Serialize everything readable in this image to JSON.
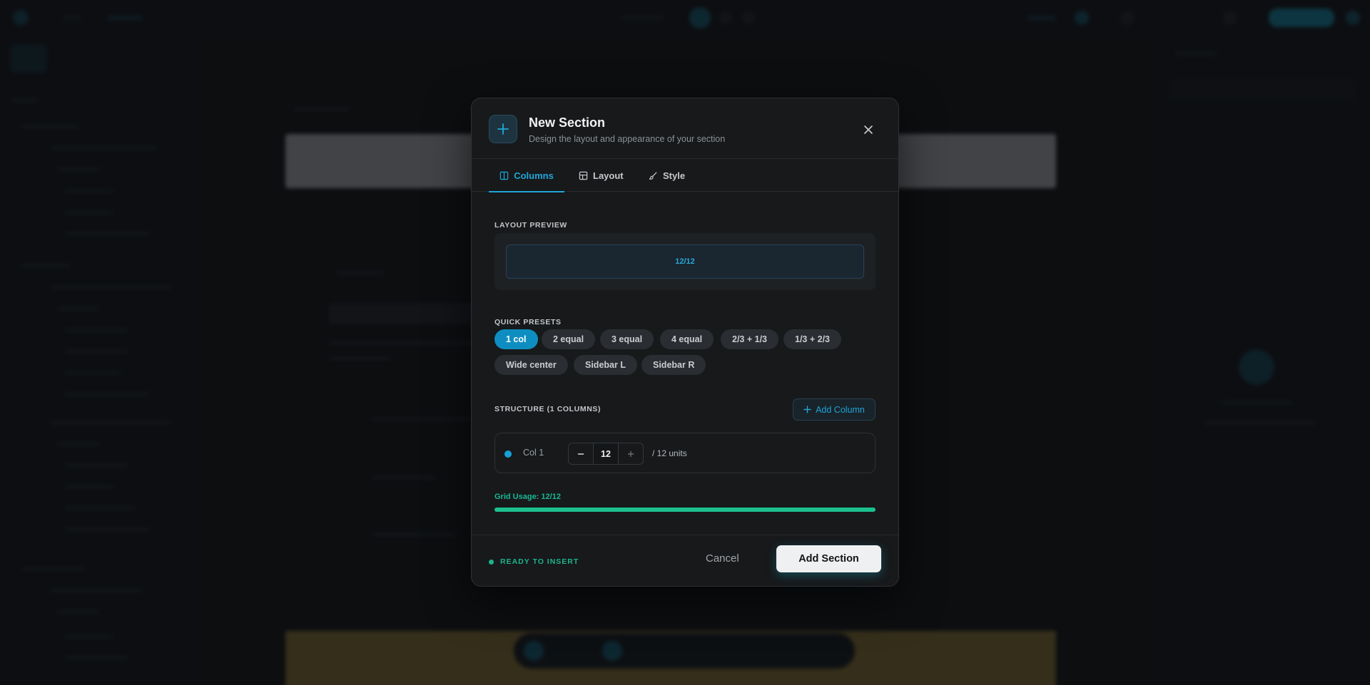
{
  "modal": {
    "title": "New Section",
    "subtitle": "Design the layout and appearance of your section",
    "header_icon": "plus-icon",
    "close_icon": "close-icon"
  },
  "tabs": [
    {
      "label": "Columns",
      "icon": "columns-icon",
      "active": true
    },
    {
      "label": "Layout",
      "icon": "layout-icon",
      "active": false
    },
    {
      "label": "Style",
      "icon": "brush-icon",
      "active": false
    }
  ],
  "layout_preview": {
    "label": "LAYOUT PREVIEW",
    "columns": [
      "12/12"
    ]
  },
  "presets": {
    "label": "QUICK PRESETS",
    "items": [
      "1 col",
      "2 equal",
      "3 equal",
      "4 equal",
      "2/3 + 1/3",
      "1/3 + 2/3",
      "Wide center",
      "Sidebar L",
      "Sidebar R"
    ],
    "active_index": 0
  },
  "structure": {
    "label": "STRUCTURE (1 COLUMNS)",
    "add_column_label": "Add Column",
    "columns": [
      {
        "name": "Col 1",
        "value": "12",
        "units": "/ 12 units"
      }
    ]
  },
  "grid_usage": {
    "label": "Grid Usage: 12/12",
    "fraction": 1.0
  },
  "footer": {
    "status": "READY TO INSERT",
    "cancel_label": "Cancel",
    "submit_label": "Add Section"
  },
  "colors": {
    "accent": "#1ea7da",
    "success": "#1cc08f",
    "surface": "#17191b"
  }
}
